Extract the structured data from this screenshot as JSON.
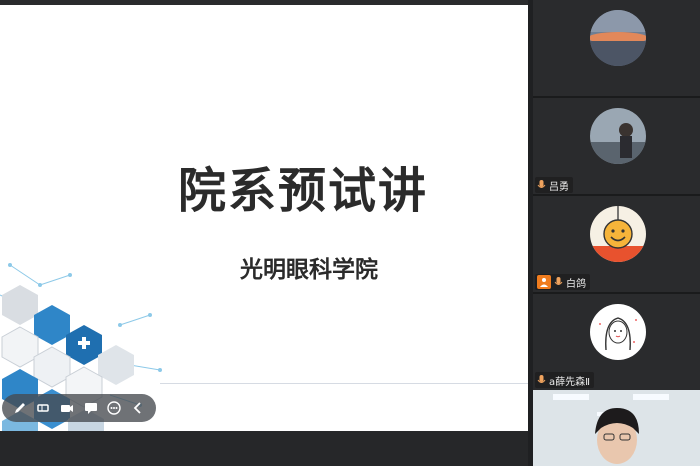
{
  "slide": {
    "title": "院系预试讲",
    "subtitle": "光明眼科学院"
  },
  "toolbar": {
    "tools": [
      "pen-icon",
      "eraser-icon",
      "camera-icon",
      "chat-icon",
      "more-icon",
      "collapse-icon"
    ]
  },
  "participants": [
    {
      "name": "",
      "avatar": "sunset-avatar",
      "muted": false
    },
    {
      "name": "吕勇",
      "avatar": "person-photo-avatar",
      "muted": false
    },
    {
      "name": "白鸽",
      "avatar": "smiley-avatar",
      "host": true
    },
    {
      "name": "a薛先森Ⅱ",
      "avatar": "cartoon-girl-avatar"
    }
  ],
  "colors": {
    "accent_orange": "#f07c1e",
    "hex_blue": "#2f86c8",
    "panel_bg": "#2b2c2e"
  }
}
